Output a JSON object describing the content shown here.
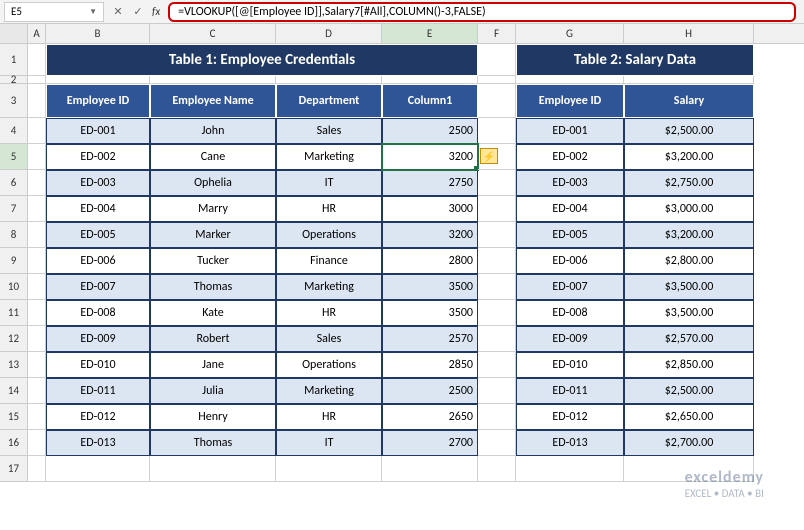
{
  "formula_bar": {
    "name_box": "E5",
    "formula": "=VLOOKUP([@[Employee ID]],Salary7[#All],COLUMN()-3,FALSE)"
  },
  "columns": [
    "A",
    "B",
    "C",
    "D",
    "E",
    "F",
    "G",
    "H"
  ],
  "selected_col": "E",
  "selected_row": "5",
  "table1": {
    "title": "Table 1: Employee Credentials",
    "headers": [
      "Employee ID",
      "Employee Name",
      "Department",
      "Column1"
    ],
    "rows": [
      {
        "id": "ED-001",
        "name": "John",
        "dept": "Sales",
        "val": "2500"
      },
      {
        "id": "ED-002",
        "name": "Cane",
        "dept": "Marketing",
        "val": "3200"
      },
      {
        "id": "ED-003",
        "name": "Ophelia",
        "dept": "IT",
        "val": "2750"
      },
      {
        "id": "ED-004",
        "name": "Marry",
        "dept": "HR",
        "val": "3000"
      },
      {
        "id": "ED-005",
        "name": "Marker",
        "dept": "Operations",
        "val": "3200"
      },
      {
        "id": "ED-006",
        "name": "Tucker",
        "dept": "Finance",
        "val": "2800"
      },
      {
        "id": "ED-007",
        "name": "Thomas",
        "dept": "Marketing",
        "val": "3500"
      },
      {
        "id": "ED-008",
        "name": "Kate",
        "dept": "HR",
        "val": "3500"
      },
      {
        "id": "ED-009",
        "name": "Robert",
        "dept": "Sales",
        "val": "2570"
      },
      {
        "id": "ED-010",
        "name": "Jane",
        "dept": "Operations",
        "val": "2850"
      },
      {
        "id": "ED-011",
        "name": "Julia",
        "dept": "Marketing",
        "val": "2500"
      },
      {
        "id": "ED-012",
        "name": "Henry",
        "dept": "HR",
        "val": "2650"
      },
      {
        "id": "ED-013",
        "name": "Thomas",
        "dept": "IT",
        "val": "2700"
      }
    ]
  },
  "table2": {
    "title": "Table 2: Salary Data",
    "headers": [
      "Employee ID",
      "Salary"
    ],
    "rows": [
      {
        "id": "ED-001",
        "sal": "$2,500.00"
      },
      {
        "id": "ED-002",
        "sal": "$3,200.00"
      },
      {
        "id": "ED-003",
        "sal": "$2,750.00"
      },
      {
        "id": "ED-004",
        "sal": "$3,000.00"
      },
      {
        "id": "ED-005",
        "sal": "$3,200.00"
      },
      {
        "id": "ED-006",
        "sal": "$2,800.00"
      },
      {
        "id": "ED-007",
        "sal": "$3,500.00"
      },
      {
        "id": "ED-008",
        "sal": "$3,500.00"
      },
      {
        "id": "ED-009",
        "sal": "$2,570.00"
      },
      {
        "id": "ED-010",
        "sal": "$2,850.00"
      },
      {
        "id": "ED-011",
        "sal": "$2,500.00"
      },
      {
        "id": "ED-012",
        "sal": "$2,650.00"
      },
      {
        "id": "ED-013",
        "sal": "$2,700.00"
      }
    ]
  },
  "watermark": {
    "title": "exceldemy",
    "sub": "EXCEL • DATA • BI"
  },
  "smart_tag_icon": "⚡"
}
